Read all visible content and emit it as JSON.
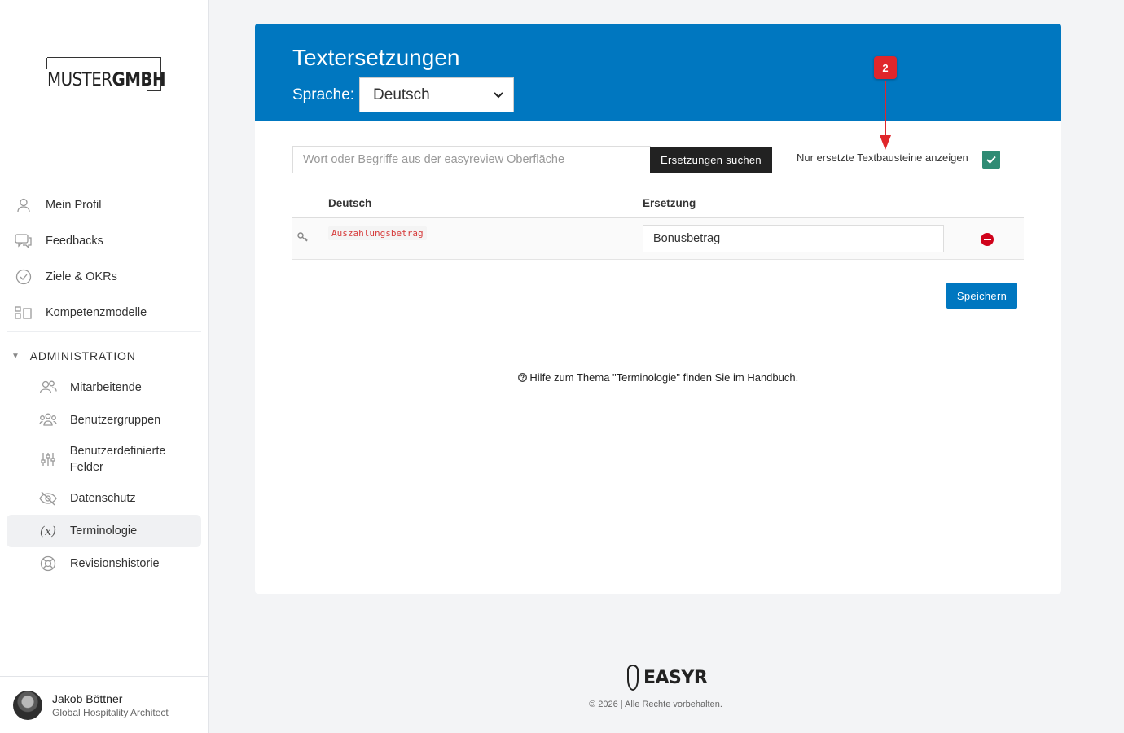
{
  "sidebar": {
    "logo": {
      "light": "MUSTER",
      "bold": "GMBH"
    },
    "items": [
      {
        "label": "Mein Profil",
        "icon": "user-icon"
      },
      {
        "label": "Feedbacks",
        "icon": "chat-icon"
      },
      {
        "label": "Ziele & OKRs",
        "icon": "check-circle-icon"
      },
      {
        "label": "Kompetenzmodelle",
        "icon": "grid-icon"
      }
    ],
    "admin_heading": "ADMINISTRATION",
    "admin_items": [
      {
        "label": "Mitarbeitende",
        "icon": "users-icon"
      },
      {
        "label": "Benutzergruppen",
        "icon": "group-icon"
      },
      {
        "label": "Benutzerdefinierte Felder",
        "icon": "sliders-icon"
      },
      {
        "label": "Datenschutz",
        "icon": "eye-off-icon"
      },
      {
        "label": "Terminologie",
        "icon": "variable-icon",
        "active": true
      },
      {
        "label": "Revisionshistorie",
        "icon": "lifebuoy-icon"
      }
    ],
    "user": {
      "name": "Jakob Böttner",
      "role": "Global Hospitality Architect"
    }
  },
  "main": {
    "title": "Textersetzungen",
    "language_label": "Sprache:",
    "language_value": "Deutsch",
    "search_placeholder": "Wort oder Begriffe aus der easyreview Oberfläche",
    "search_button": "Ersetzungen suchen",
    "filter_label": "Nur ersetzte Textbausteine anzeigen",
    "filter_checked": true,
    "columns": [
      "Deutsch",
      "Ersetzung"
    ],
    "rows": [
      {
        "key": "Auszahlungsbetrag",
        "replacement": "Bonusbetrag"
      }
    ],
    "save_button": "Speichern",
    "help_text": "Hilfe zum Thema \"Terminologie\" finden Sie im Handbuch."
  },
  "annotation": {
    "label": "2",
    "color": "#e0262b"
  },
  "footer": {
    "brand": "EASYR",
    "copyright": "© 2026 | Alle Rechte vorbehalten."
  },
  "colors": {
    "primary": "#0077c0",
    "checkbox": "#2e8b74",
    "delete": "#d0021b"
  }
}
